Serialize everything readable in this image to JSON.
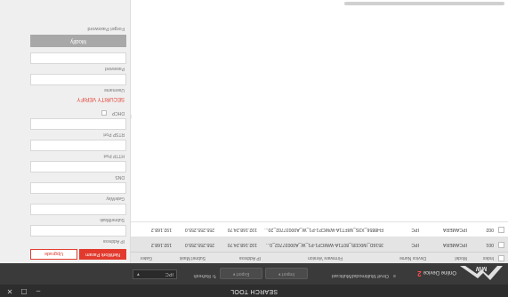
{
  "window": {
    "title": "SEARCH TOOL",
    "controls": {
      "minimize": "–",
      "maximize": "☐",
      "close": "✕"
    }
  },
  "logo": {
    "text": "MW",
    "alt": "logo"
  },
  "toolbar": {
    "online_label": "Online Device",
    "online_count": "2",
    "multicast_label": "Onvif Multimodal/Multicast",
    "import_label": "Import",
    "export_label": "Export",
    "refresh_label": "Refresh",
    "search_value": "IPC",
    "search_icon": "dropdown-icon"
  },
  "table": {
    "headers": [
      "Index",
      "Model",
      "Device Name",
      "Firmware Version",
      "IP Address",
      "Subnet Mask",
      "Gatev"
    ],
    "rows": [
      {
        "index": "001",
        "model": "IPCAMERA",
        "device_name": "IPC",
        "firmware": "3516D_IMX335_80T1A-W/MCP1-P1_W_A00037702_0...",
        "ip": "192.168.24.70",
        "mask": "255.255.255.0",
        "gateway": "192.168.2"
      },
      {
        "index": "002",
        "model": "IPCAMERA",
        "device_name": "IPC",
        "firmware": "FH8856_X3S_WIFT1A-W/MCP1-P1_W_A00037702_20...",
        "ip": "192.168.24.70",
        "mask": "255.255.255.0",
        "gateway": "192.168.2"
      }
    ]
  },
  "panel": {
    "tabs": {
      "network_param": "NetWork Param",
      "upgrade": "Upgrade"
    },
    "fields": {
      "ip_address": "IP Address",
      "subnet_mask": "SubnetMask",
      "gateway": "GateWay",
      "dns": "DNS",
      "http_port": "HTTP Port",
      "rtsp_port": "RTSP Port",
      "dhcp": "DHCP"
    },
    "security": {
      "title": "SECURITY VERIFY",
      "username": "Username",
      "password": "Password",
      "modify": "Modify",
      "forgot": "Forget Password"
    }
  },
  "colors": {
    "accent": "#e23b2e",
    "titlebar": "#2d2d2d",
    "toolbar": "#3a3a3a"
  }
}
